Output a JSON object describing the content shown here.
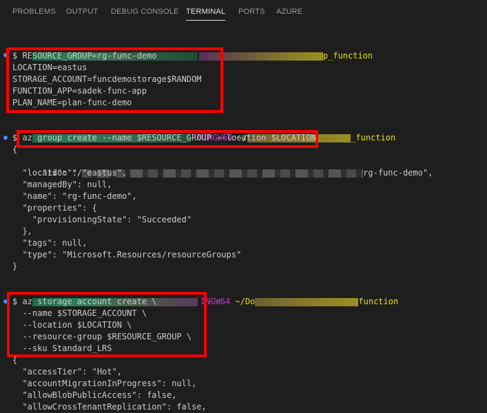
{
  "panel": {
    "tabs": [
      {
        "label": "PROBLEMS"
      },
      {
        "label": "OUTPUT"
      },
      {
        "label": "DEBUG CONSOLE"
      },
      {
        "label": "TERMINAL"
      },
      {
        "label": "PORTS"
      },
      {
        "label": "AZURE"
      }
    ],
    "active_tab": "TERMINAL"
  },
  "terminal": {
    "prompt1": {
      "path_tail": "p_function"
    },
    "block1": [
      "$ RESOURCE_GROUP=rg-func-demo",
      "LOCATION=eastus",
      "STORAGE_ACCOUNT=funcdemostorage$RANDOM",
      "FUNCTION_APP=sadek-func-app",
      "PLAN_NAME=plan-func-demo"
    ],
    "prompt2": {
      "shell": "MINGW64",
      "path_head": "~/",
      "path_tail": "_function"
    },
    "cmd2": "$ az group create --name $RESOURCE_GROUP --location $LOCATION",
    "json1": {
      "open": "{",
      "id_key": "  \"id\": \"/",
      "id_tail": "rg-func-demo\",",
      "lines": [
        "  \"location\": \"eastus\",",
        "  \"managedBy\": null,",
        "  \"name\": \"rg-func-demo\",",
        "  \"properties\": {",
        "    \"provisioningState\": \"Succeeded\"",
        "  },",
        "  \"tags\": null,",
        "  \"type\": \"Microsoft.Resources/resourceGroups\"",
        "}"
      ]
    },
    "prompt3": {
      "shell": "INGW64",
      "path_head": "~/Do",
      "path_tail": "function"
    },
    "block3": [
      "$ az storage account create \\",
      "  --name $STORAGE_ACCOUNT \\",
      "  --location $LOCATION \\",
      "  --resource-group $RESOURCE_GROUP \\",
      "  --sku Standard_LRS"
    ],
    "json2": [
      "{",
      "  \"accessTier\": \"Hot\",",
      "  \"accountMigrationInProgress\": null,",
      "  \"allowBlobPublicAccess\": false,",
      "  \"allowCrossTenantReplication\": false,"
    ]
  },
  "colors": {
    "background": "#1e1e1e",
    "text": "#cccccc",
    "prompt_path": "#e5e510",
    "shell_name": "#bc3fbc",
    "highlight_box": "#ff0000",
    "decoration_dot": "#3794ff"
  }
}
